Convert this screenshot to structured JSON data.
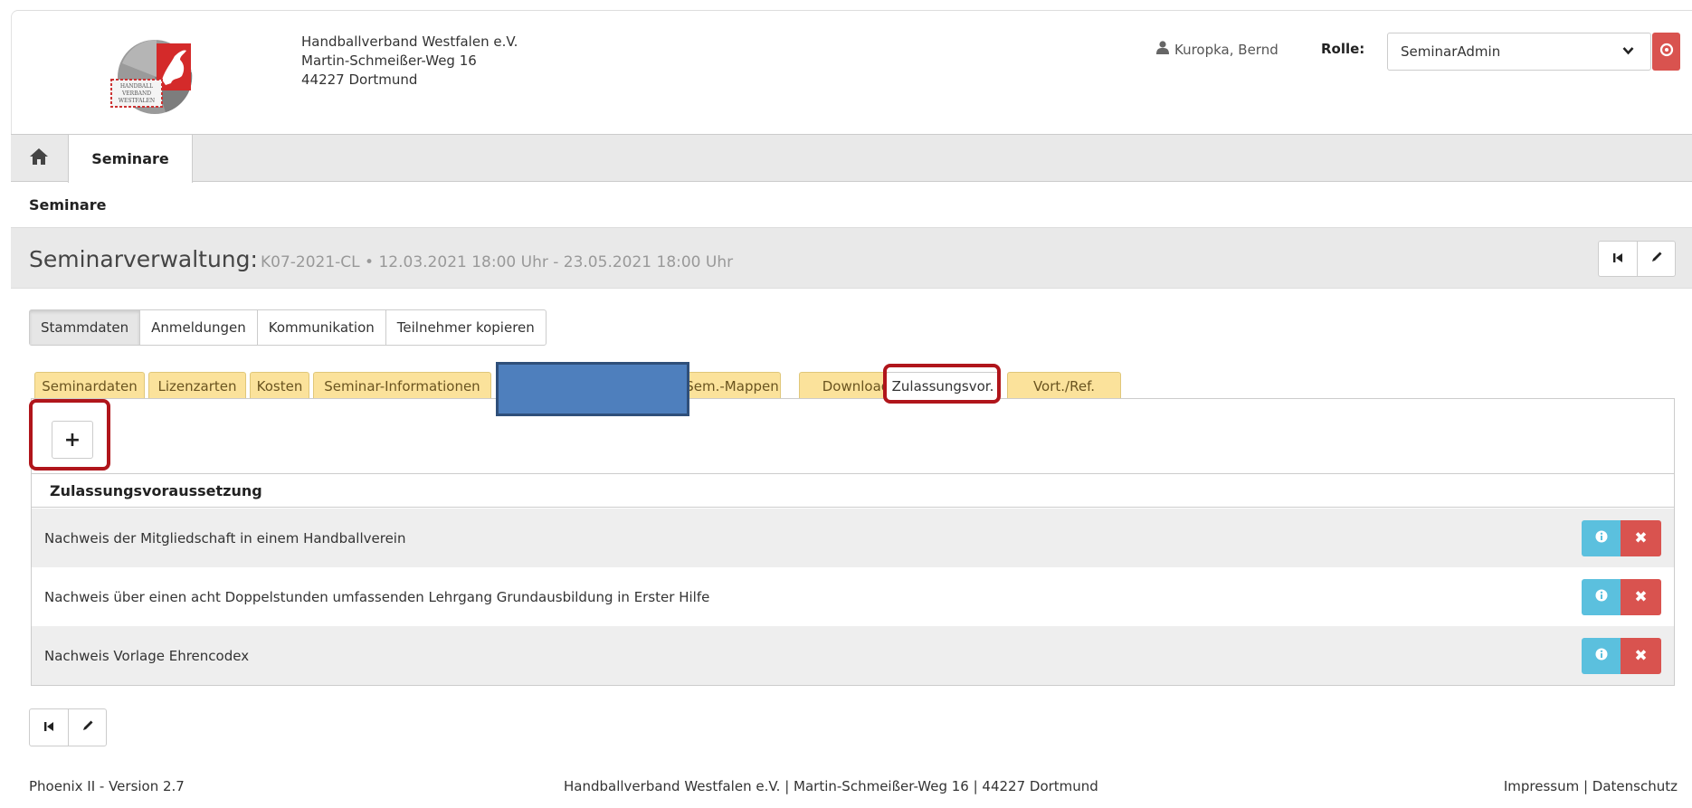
{
  "header": {
    "org_lines": [
      "Handballverband Westfalen e.V.",
      "Martin-Schmeißer-Weg 16",
      "44227 Dortmund"
    ],
    "logo_text": [
      "HANDBALL",
      "VERBAND",
      "WESTFALEN"
    ],
    "user_icon": "user-icon",
    "user_name": "Kuropka, Bernd",
    "role_label": "Rolle:",
    "role_value": "SeminarAdmin",
    "power_icon": "power-icon"
  },
  "nav": {
    "home_icon": "home-icon",
    "tabs": [
      {
        "label": "Seminare"
      }
    ]
  },
  "breadcrumb": "Seminare",
  "title": {
    "main": "Seminarverwaltung:",
    "sub": "K07-2021-CL • 12.03.2021 18:00 Uhr - 23.05.2021 18:00 Uhr"
  },
  "main_tabs": [
    {
      "label": "Stammdaten",
      "active": true
    },
    {
      "label": "Anmeldungen"
    },
    {
      "label": "Kommunikation"
    },
    {
      "label": "Teilnehmer kopieren"
    }
  ],
  "sub_tabs": [
    {
      "label": "Seminardaten"
    },
    {
      "label": "Lizenzarten"
    },
    {
      "label": "Kosten"
    },
    {
      "label": "Seminar-Informationen"
    },
    {
      "label": "Sem.-Mappen"
    },
    {
      "label": "Download"
    },
    {
      "label": "Zulassungsvor.",
      "active": true
    },
    {
      "label": "Vort./Ref."
    }
  ],
  "add_button": "+",
  "table": {
    "header": "Zulassungsvoraussetzung",
    "rows": [
      "Nachweis der Mitgliedschaft in einem Handballverein",
      "Nachweis über einen acht Doppelstunden umfassenden Lehrgang Grundausbildung in Erster Hilfe",
      "Nachweis Vorlage Ehrencodex"
    ],
    "delete_glyph": "✖"
  },
  "footer": {
    "left": "Phoenix II - Version 2.7",
    "middle": "Handballverband Westfalen e.V. | Martin-Schmeißer-Weg 16 | 44227 Dortmund",
    "impressum": "Impressum",
    "separator": " | ",
    "datenschutz": "Datenschutz"
  },
  "colors": {
    "tab_yellow": "#fbe29b",
    "danger": "#d9534f",
    "info": "#5bc0de",
    "highlight": "#b0151b",
    "redaction": "#4e7fbd"
  }
}
